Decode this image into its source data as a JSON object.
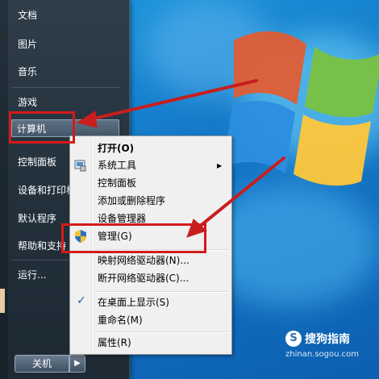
{
  "start_menu": {
    "items": [
      {
        "label": "文档"
      },
      {
        "label": "图片"
      },
      {
        "label": "音乐"
      },
      {
        "label": "游戏"
      },
      {
        "label": "计算机"
      },
      {
        "label": "控制面板"
      },
      {
        "label": "设备和打印机"
      },
      {
        "label": "默认程序"
      },
      {
        "label": "帮助和支持"
      },
      {
        "label": "运行..."
      }
    ],
    "shutdown_label": "关机",
    "shutdown_arrow": "▶"
  },
  "context_menu": {
    "items": [
      {
        "label": "打开(O)"
      },
      {
        "label": "系统工具"
      },
      {
        "label": "控制面板"
      },
      {
        "label": "添加或删除程序"
      },
      {
        "label": "设备管理器"
      },
      {
        "label": "管理(G)"
      },
      {
        "label": "映射网络驱动器(N)..."
      },
      {
        "label": "断开网络驱动器(C)..."
      },
      {
        "label": "在桌面上显示(S)"
      },
      {
        "label": "重命名(M)"
      },
      {
        "label": "属性(R)"
      }
    ],
    "submenu_arrow": "▶",
    "check_mark": "✓"
  },
  "watermark": {
    "logo_letter": "S",
    "name": "搜狗指南",
    "url": "zhinan.sogou.com"
  },
  "colors": {
    "highlight": "#d41a1a",
    "desktop": "#1479c9"
  }
}
